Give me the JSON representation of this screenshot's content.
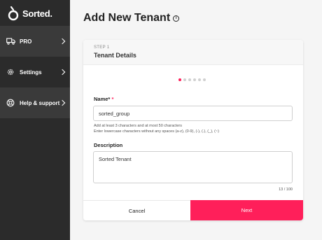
{
  "brand": {
    "name": "Sorted.",
    "accent": "#ff1f5a"
  },
  "sidebar": {
    "items": [
      {
        "label": "PRO",
        "icon": "truck-icon"
      },
      {
        "label": "Settings",
        "icon": "gear-icon"
      },
      {
        "label": "Help & support",
        "icon": "lifebuoy-icon"
      }
    ]
  },
  "page": {
    "title": "Add New Tenant",
    "title_icon": "info-icon"
  },
  "step": {
    "label": "STEP 1",
    "title": "Tenant Details",
    "current": 1,
    "total": 6
  },
  "form": {
    "name": {
      "label": "Name*",
      "required_mark": "*",
      "value": "sorted_group",
      "hint_1": "Add at least 3 characters and at most 50 characters",
      "hint_2": "Enter lowercase characters without any spaces (a-z), (0-9), (-), (.), (_), (~)"
    },
    "description": {
      "label": "Description",
      "value": "Sorted Tenant",
      "counter": "13 / 100"
    }
  },
  "actions": {
    "cancel": "Cancel",
    "next": "Next"
  }
}
